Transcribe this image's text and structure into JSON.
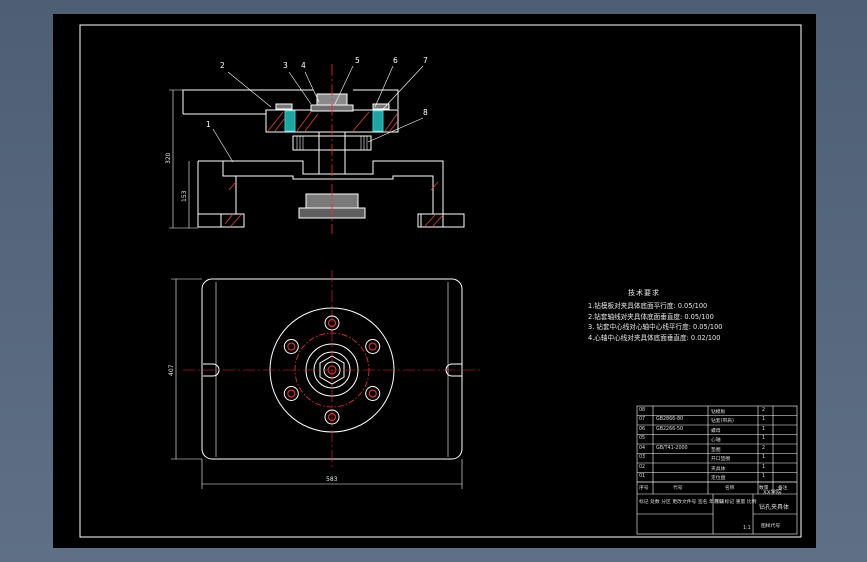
{
  "drawing": {
    "callouts": [
      "1",
      "2",
      "3",
      "4",
      "5",
      "6",
      "7",
      "8"
    ],
    "dimensions": {
      "front_height": "320",
      "front_sub_height": "153",
      "plan_height": "407",
      "plan_width": "583"
    },
    "technical_requirements": {
      "title": "技术要求",
      "items": [
        "1.钻模板对夹具体底面平行度: 0.05/100",
        "2.钻套轴线对夹具体底面垂直度: 0.05/100",
        "3. 钻套中心线对心轴中心线平行度: 0.05/100",
        "4.心轴中心线对夹具体底面垂直度: 0.02/100"
      ]
    },
    "title_block": {
      "parts_rows": [
        {
          "no": "08",
          "code": "",
          "name": "钻模板",
          "qty": "2"
        },
        {
          "no": "07",
          "code": "GB2866-80",
          "name": "钻套(带肩)",
          "qty": "1"
        },
        {
          "no": "06",
          "code": "GB2266-50",
          "name": "螺母",
          "qty": "1"
        },
        {
          "no": "05",
          "code": "",
          "name": "心轴",
          "qty": "1"
        },
        {
          "no": "04",
          "code": "GB/T41-2000",
          "name": "垫圈",
          "qty": "2"
        },
        {
          "no": "03",
          "code": "",
          "name": "开口垫圈",
          "qty": "1"
        },
        {
          "no": "02",
          "code": "",
          "name": "夹具体",
          "qty": "1"
        },
        {
          "no": "01",
          "code": "",
          "name": "定位盘",
          "qty": "1"
        }
      ],
      "header": {
        "no": "序号",
        "code": "代号",
        "name": "名称",
        "qty": "数量",
        "remark": "备注"
      },
      "scale_label": "1:1",
      "school": "XX学院",
      "title": "钻孔夹具体",
      "drawing_no": "图样代号",
      "designer_row": "标记 处数 分区 更改文件号 签名 年月日",
      "weight_label": "阶段标记 重量 比例"
    },
    "colors": {
      "background": "#000000",
      "line": "#ffffff",
      "center_line": "#ff2020",
      "hatch": "#ff3b3b",
      "cyan": "#27d1d1",
      "bolt_gray": "#a9a9a9"
    }
  }
}
